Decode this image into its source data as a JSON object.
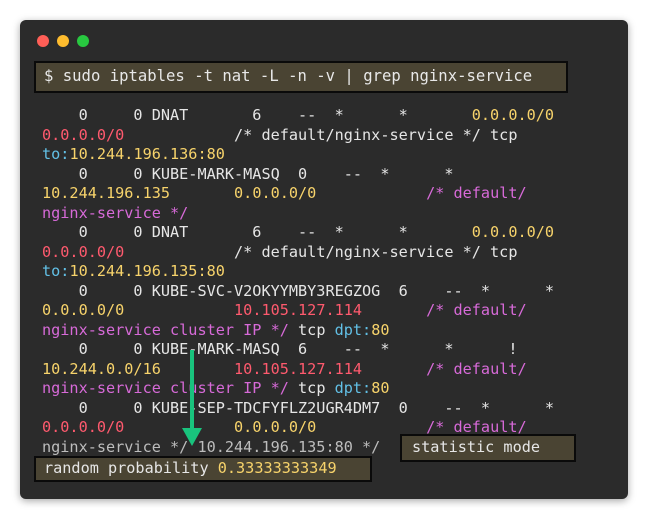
{
  "window": {
    "controls": [
      "close",
      "minimize",
      "maximize"
    ]
  },
  "command": "$ sudo iptables -t nat -L -n -v | grep nginx-service",
  "lines": [
    [
      {
        "t": "    0     0 DNAT       6    --  *      *       ",
        "c": "w"
      },
      {
        "t": "0.0.0.0/0",
        "c": "y"
      }
    ],
    [
      {
        "t": "0.0.0.0/0",
        "c": "r"
      },
      {
        "t": "            /* default/nginx-service */ tcp",
        "c": "w"
      }
    ],
    [
      {
        "t": "to:",
        "c": "c"
      },
      {
        "t": "10.244.196.136:80",
        "c": "y"
      }
    ],
    [
      {
        "t": "    0     0 KUBE-MARK-MASQ  0    --  *      *",
        "c": "w"
      }
    ],
    [
      {
        "t": "10.244.196.135",
        "c": "y"
      },
      {
        "t": "       ",
        "c": "w"
      },
      {
        "t": "0.0.0.0/0",
        "c": "y"
      },
      {
        "t": "            ",
        "c": "w"
      },
      {
        "t": "/* default/",
        "c": "m"
      }
    ],
    [
      {
        "t": "nginx-service */",
        "c": "m"
      }
    ],
    [
      {
        "t": "    0     0 DNAT       6    --  *      *       ",
        "c": "w"
      },
      {
        "t": "0.0.0.0/0",
        "c": "y"
      }
    ],
    [
      {
        "t": "0.0.0.0/0",
        "c": "r"
      },
      {
        "t": "            /* default/nginx-service */ tcp",
        "c": "w"
      }
    ],
    [
      {
        "t": "to:",
        "c": "c"
      },
      {
        "t": "10.244.196.135:80",
        "c": "y"
      }
    ],
    [
      {
        "t": "    0     0 KUBE-SVC-V2OKYYMBY3REGZOG  6    --  *      *",
        "c": "w"
      }
    ],
    [
      {
        "t": "0.0.0.0/0",
        "c": "y"
      },
      {
        "t": "            ",
        "c": "w"
      },
      {
        "t": "10.105.127.114",
        "c": "r"
      },
      {
        "t": "       ",
        "c": "w"
      },
      {
        "t": "/* default/",
        "c": "m"
      }
    ],
    [
      {
        "t": "nginx-service cluster IP */",
        "c": "m"
      },
      {
        "t": " tcp ",
        "c": "w"
      },
      {
        "t": "dpt:",
        "c": "c"
      },
      {
        "t": "80",
        "c": "y"
      }
    ],
    [
      {
        "t": "    0     0 KUBE-MARK-MASQ  6    --  *      *      !",
        "c": "w"
      }
    ],
    [
      {
        "t": "10.244.0.0/16",
        "c": "y"
      },
      {
        "t": "        ",
        "c": "w"
      },
      {
        "t": "10.105.127.114",
        "c": "r"
      },
      {
        "t": "       ",
        "c": "w"
      },
      {
        "t": "/* default/",
        "c": "m"
      }
    ],
    [
      {
        "t": "nginx-service cluster IP */",
        "c": "m"
      },
      {
        "t": " tcp ",
        "c": "w"
      },
      {
        "t": "dpt:",
        "c": "c"
      },
      {
        "t": "80",
        "c": "y"
      }
    ],
    [
      {
        "t": "    0     0 KUBE-SEP-TDCFYFLZ2UGR4DM7  0    --  *      *",
        "c": "w"
      }
    ],
    [
      {
        "t": "0.0.0.0/0",
        "c": "r"
      },
      {
        "t": "            ",
        "c": "w"
      },
      {
        "t": "0.0.0.0/0",
        "c": "y"
      },
      {
        "t": "            ",
        "c": "w"
      },
      {
        "t": "/* default/",
        "c": "m"
      }
    ],
    [
      {
        "t": "nginx-service */ 10.244.196.135:80 */",
        "c": "g"
      }
    ]
  ],
  "highlight_statistic": "statistic mode",
  "highlight_random_label": "random probability",
  "highlight_random_value": "0.33333333349",
  "colors": {
    "terminal_bg": "#2b2b2b",
    "highlight_bg": "#4a4433",
    "red": "#ff5a6e",
    "yellow": "#f7d36b",
    "magenta": "#d76ad8",
    "cyan": "#62c0e6",
    "arrow": "#19c37d"
  },
  "annotation": {
    "icon": "down-arrow-icon"
  }
}
